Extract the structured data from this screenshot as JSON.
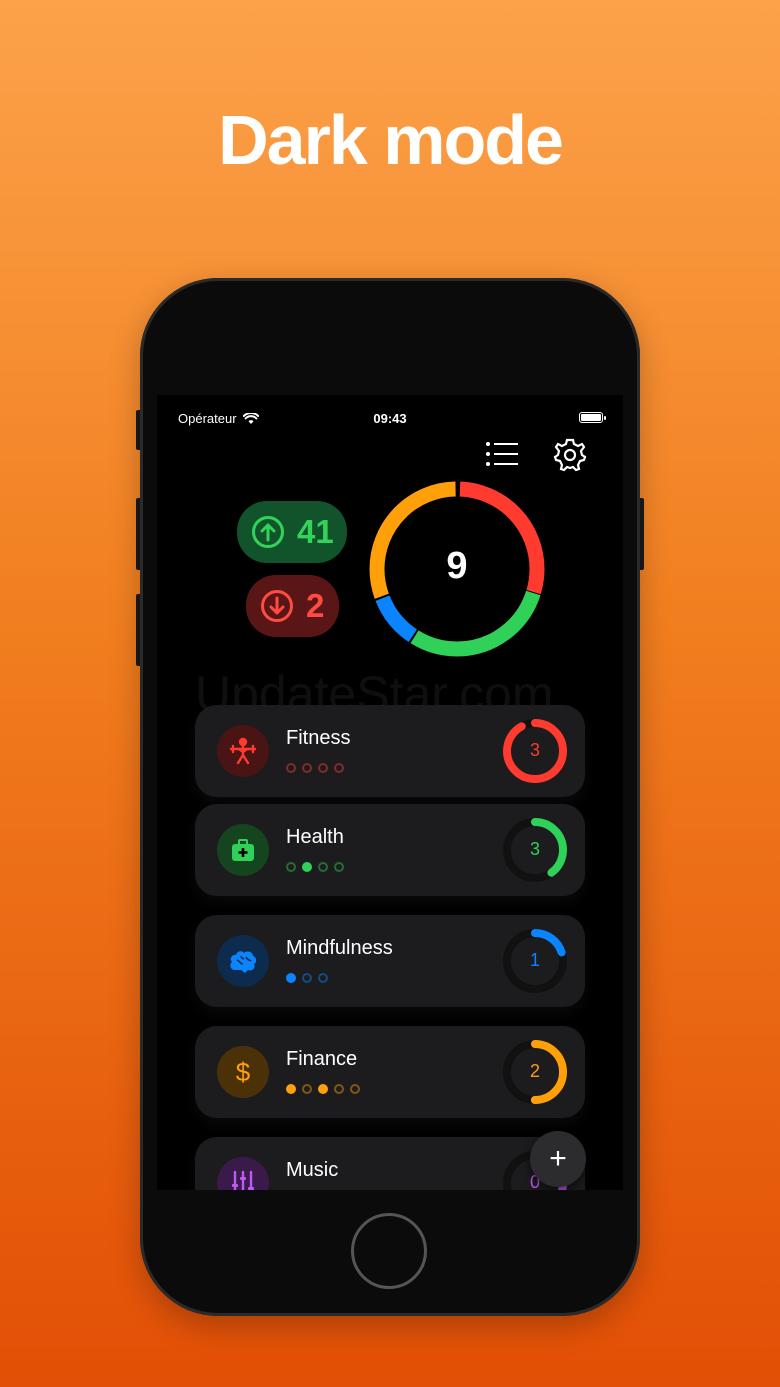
{
  "headline": "Dark mode",
  "status_bar": {
    "carrier": "Opérateur",
    "time": "09:43"
  },
  "summary": {
    "up_count": "41",
    "down_count": "2",
    "ring_total": "9"
  },
  "watermark": "UpdateStar.com",
  "categories": [
    {
      "name": "Fitness",
      "count": "3",
      "color": "#ff3b30",
      "bg": "#4a1414",
      "dots_total": 4,
      "dots_filled": 0,
      "ring_fraction": 0.92
    },
    {
      "name": "Health",
      "count": "3",
      "color": "#30d158",
      "bg": "#15451f",
      "dots_total": 4,
      "dots_filled": 1,
      "ring_fraction": 0.4
    },
    {
      "name": "Mindfulness",
      "count": "1",
      "color": "#0a84ff",
      "bg": "#0d2b4d",
      "dots_total": 3,
      "dots_filled": 1,
      "ring_fraction": 0.2
    },
    {
      "name": "Finance",
      "count": "2",
      "color": "#ff9f0a",
      "bg": "#4a3108",
      "dots_total": 5,
      "dots_filled": 2,
      "ring_fraction": 0.5
    },
    {
      "name": "Music",
      "count": "0",
      "color": "#bf5af2",
      "bg": "#3a1a4a",
      "dots_total": 0,
      "dots_filled": 0,
      "ring_fraction": 0.3
    }
  ],
  "icons": {
    "list": "list-icon",
    "settings": "gear-icon",
    "add": "plus-icon"
  },
  "fab_label": "+"
}
